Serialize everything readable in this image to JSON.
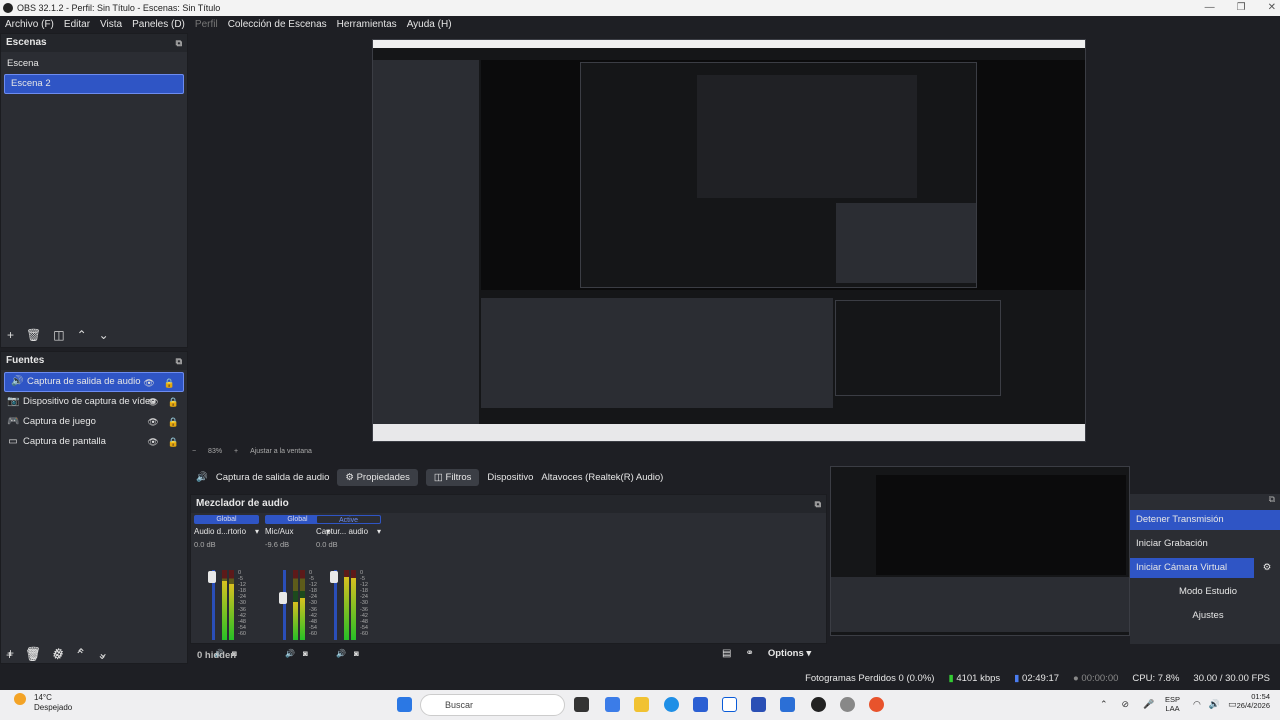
{
  "window": {
    "title": "OBS 32.1.2 - Perfil: Sin Título - Escenas: Sin Título"
  },
  "menu": [
    "Archivo (F)",
    "Editar",
    "Vista",
    "Paneles (D)",
    "Perfil",
    "Colección de Escenas",
    "Herramientas",
    "Ayuda (H)"
  ],
  "scenes": {
    "title": "Escenas",
    "items": [
      "Escena",
      "Escena 2"
    ],
    "selected": 1
  },
  "sources": {
    "title": "Fuentes",
    "items": [
      {
        "label": "Captura de salida de audio",
        "icon": "speaker-icon"
      },
      {
        "label": "Dispositivo de captura de vídeo",
        "icon": "camera-icon"
      },
      {
        "label": "Captura de juego",
        "icon": "gamepad-icon"
      },
      {
        "label": "Captura de pantalla",
        "icon": "monitor-icon"
      }
    ]
  },
  "preview": {
    "zoom": "83%",
    "fit": "Ajustar a la ventana"
  },
  "source_controls": {
    "source": "Captura de salida de audio",
    "properties": "Propiedades",
    "filters": "Filtros",
    "device_label": "Dispositivo",
    "device_value": "Altavoces (Realtek(R) Audio)"
  },
  "mixer": {
    "title": "Mezclador de audio",
    "channels": [
      {
        "badge": "Global",
        "name": "Audio d...rtorio",
        "db": "0.0 dB",
        "level": 0.85,
        "fader": 0.95
      },
      {
        "badge": "Global",
        "name": "Mic/Aux",
        "db": "-9.6 dB",
        "level": 0.55,
        "fader": 0.65
      },
      {
        "badge": "Active",
        "name": "Captur... audio",
        "db": "0.0 dB",
        "level": 0.9,
        "fader": 0.95
      }
    ],
    "scale": [
      "0",
      "-5",
      "-12",
      "-18",
      "-24",
      "-30",
      "-36",
      "-42",
      "-48",
      "-54",
      "-60"
    ],
    "hidden": "0 hidden",
    "options": "Options"
  },
  "controls": {
    "stop_stream": "Detener Transmisión",
    "start_rec": "Iniciar Grabación",
    "virtual_cam": "Iniciar Cámara Virtual",
    "studio": "Modo Estudio",
    "settings": "Ajustes"
  },
  "status": {
    "dropped": "Fotogramas Perdidos 0 (0.0%)",
    "kbps": "4101 kbps",
    "stream_time": "02:49:17",
    "rec_time": "00:00:00",
    "cpu": "CPU: 7.8%",
    "fps": "30.00 / 30.00 FPS"
  },
  "taskbar": {
    "temp": "14°C",
    "weather": "Despejado",
    "search": "Buscar",
    "lang1": "ESP",
    "lang2": "LAA",
    "time": "01:54",
    "date": "26/4/2026"
  },
  "colors": {
    "accent": "#2f55c5",
    "bg": "#1e1f24",
    "panel": "#2b2d33"
  }
}
